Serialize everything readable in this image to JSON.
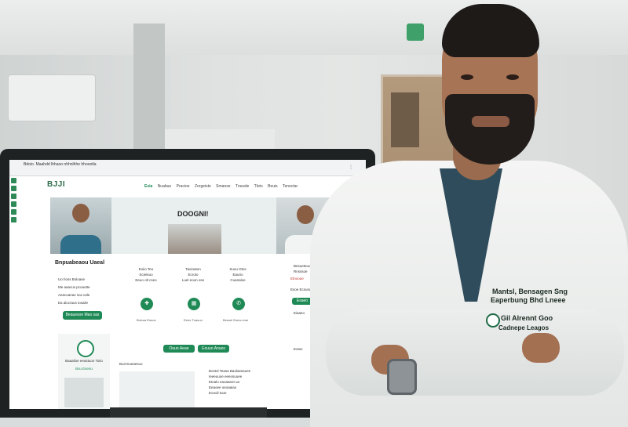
{
  "browser": {
    "title": "Bdoio. Maahdd lhhaoo  nhhnlhhe  hhoootla",
    "menu_dots": "⋮"
  },
  "site": {
    "logo": "BJJI",
    "nav": [
      "Esia",
      "Nuabue",
      "Pracioe",
      "Zorgeiste",
      "Smanse",
      "Tnsusle",
      "Tbris",
      "Beuis",
      "Tenoctar"
    ],
    "hero_title": "DOOGNI!",
    "section_title": "Bnpuabeaou Uaeal",
    "list_items": [
      "Uo hoss Boloase",
      "Me aaacus pcoaotte",
      "Aeacoanas sca cale",
      "Ea alucraus tosaile"
    ],
    "appointments_button": "Beauesoe Mao sas",
    "columns": [
      {
        "title": "Eoiio Teo",
        "subtitle": "Scieieuo",
        "note": "Eeuo olt cseo",
        "link": "Bulcua Eseue"
      },
      {
        "title": "Taoioaton",
        "subtitle": "Ecroto",
        "note": "Luel eoon ose",
        "link": "Eeeu Tuaouo"
      },
      {
        "title": "Suou Otos",
        "subtitle": "Eaurio",
        "note": "Cuanaloe",
        "link": "Besuel Eseou ese"
      }
    ],
    "buttons": [
      "Ouuo Aeae",
      "Eouuo Anues"
    ],
    "card_left_title": "Baaalioe eeastuon Toiio",
    "card_left_sub": "Bsu Esenu",
    "card_mid_title": "Bu3 Eueaesuo",
    "news": [
      "Bostol Teasa Baolaeasuee",
      "Ieeeuuoe eeeosuuee",
      "Etoalo eaoaaeet ua",
      "Eeaoee oeoaaiao",
      "Eoooil tuue"
    ],
    "right_panel": [
      "Besueteuo",
      "Rnsssoe",
      "Etnooue",
      "Esoe Ecsusael",
      "Eiaaeo",
      "Eotus"
    ],
    "right_button": "Esaeo"
  },
  "coat_embroidery": {
    "line1": "Mantsl, Bensagen Sng",
    "line2": "Eaperbung Bhd Lneee",
    "line3": "Gil Alrennt Goo",
    "line4": "Cadnepe Leagos"
  }
}
